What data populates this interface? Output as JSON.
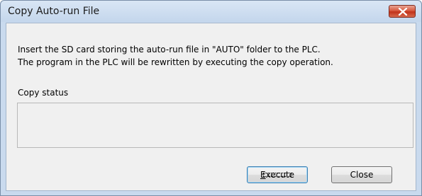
{
  "window": {
    "title": "Copy Auto-run File"
  },
  "message": {
    "line1": "Insert the SD card storing the auto-run file in \"AUTO\" folder to the PLC.",
    "line2": "The program in the PLC will be rewritten by executing the copy operation."
  },
  "status": {
    "label": "Copy status",
    "value": ""
  },
  "buttons": {
    "execute": {
      "accel": "E",
      "rest": "xecute"
    },
    "close": "Close"
  },
  "icons": {
    "title_close": "close-x-icon"
  },
  "colors": {
    "titlebar": "#c9daee",
    "close_button": "#c1321a",
    "client_background": "#f0f0f0"
  }
}
